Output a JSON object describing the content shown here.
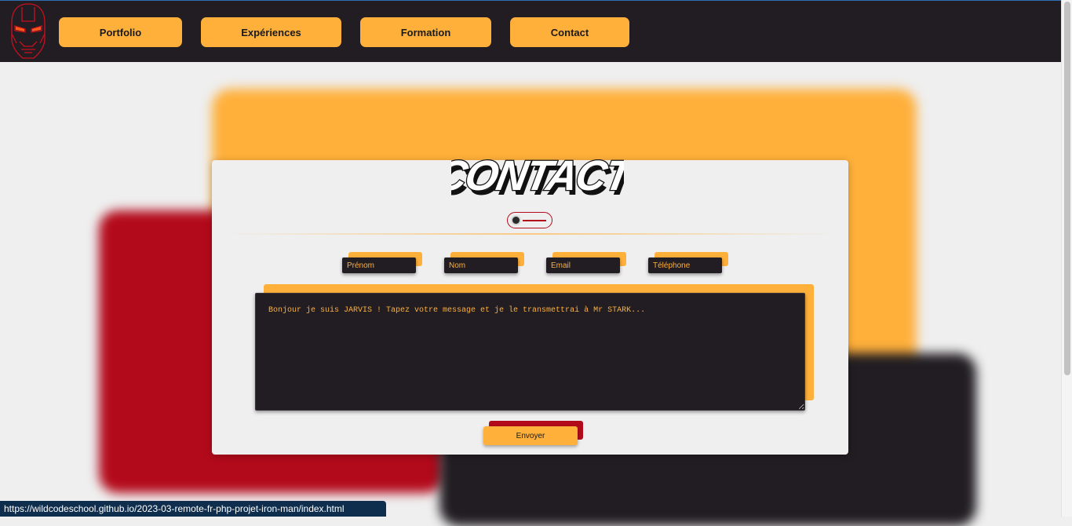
{
  "nav": {
    "items": [
      {
        "label": "Portfolio"
      },
      {
        "label": "Expériences"
      },
      {
        "label": "Formation"
      },
      {
        "label": "Contact"
      }
    ]
  },
  "contact": {
    "title": "CONTACT",
    "fields": {
      "firstname_placeholder": "Prénom",
      "lastname_placeholder": "Nom",
      "email_placeholder": "Email",
      "phone_placeholder": "Téléphone"
    },
    "message_placeholder": "Bonjour je suis JARVIS ! Tapez votre message et je le transmettrai à Mr STARK...",
    "send_label": "Envoyer"
  },
  "status_bar": {
    "url": "https://wildcodeschool.github.io/2023-03-remote-fr-php-projet-iron-man/index.html"
  },
  "colors": {
    "accent": "#ffb03b",
    "dark": "#211d22",
    "red": "#b30a1b"
  },
  "icons": {
    "logo": "iron-man-helmet-icon"
  }
}
